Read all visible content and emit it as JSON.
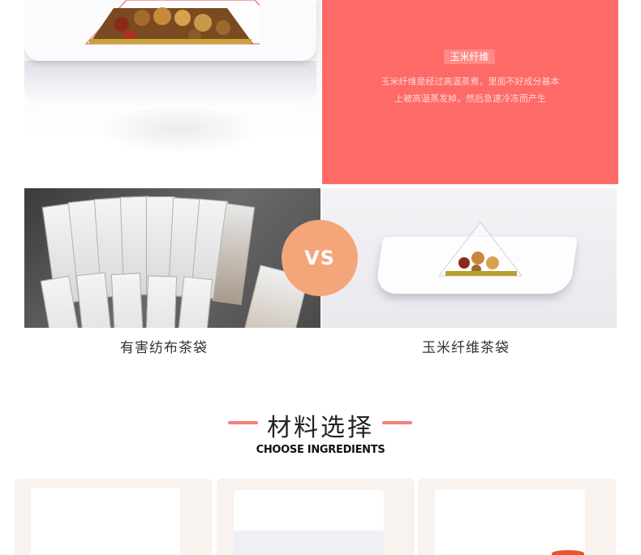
{
  "top_photo": {
    "alt_icon": "tea-pyramid-bag-icon"
  },
  "red_panel": {
    "top_cut_text": "",
    "tag": "玉米纤维",
    "desc_line1": "玉米纤维是经过高温蒸煮，里面不好成分基本",
    "desc_line2": "上被高温蒸发掉，然后急速冷冻而产生",
    "bg_color": "#fd6a67"
  },
  "compare": {
    "vs_label": "VS",
    "left_caption": "有害纺布茶袋",
    "right_caption": "玉米纤维茶袋"
  },
  "section": {
    "title": "材料选择",
    "subtitle": "CHOOSE INGREDIENTS",
    "accent": "#f47f7a"
  }
}
